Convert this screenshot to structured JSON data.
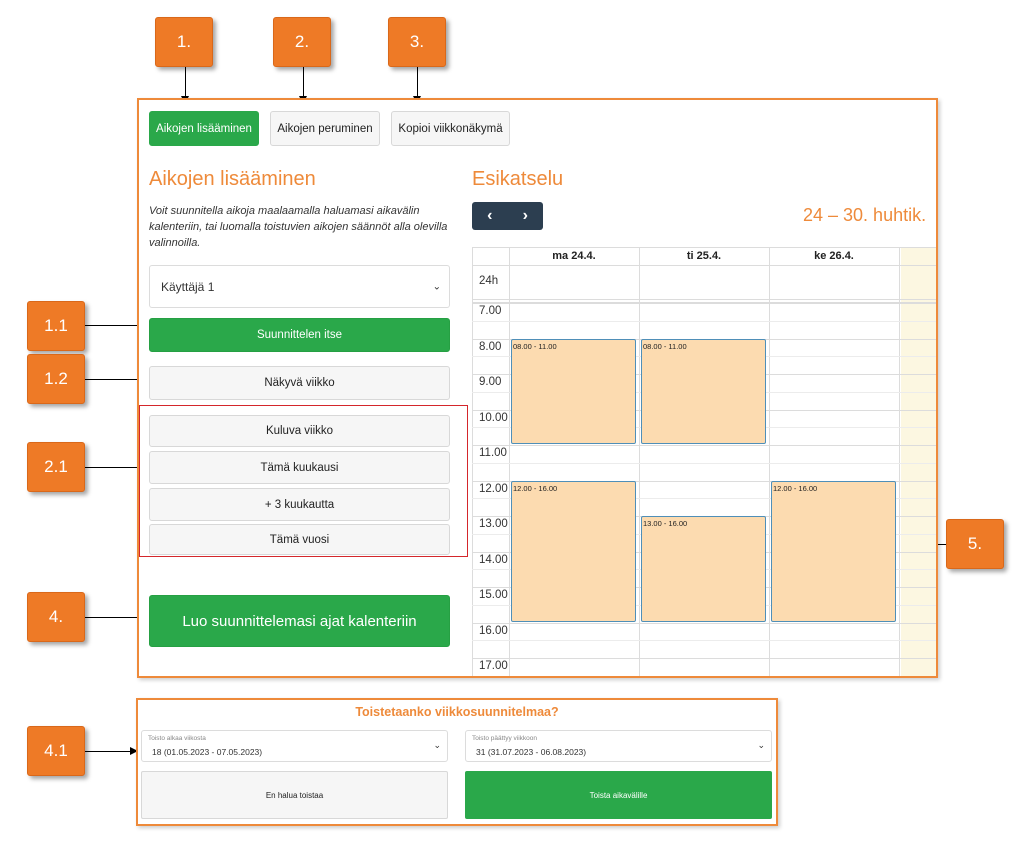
{
  "callouts": {
    "c1": "1.",
    "c2": "2.",
    "c3": "3.",
    "c11": "1.1",
    "c12": "1.2",
    "c21": "2.1",
    "c4": "4.",
    "c41": "4.1",
    "c5": "5."
  },
  "tabs": [
    {
      "label": "Aikojen lisääminen",
      "active": true
    },
    {
      "label": "Aikojen peruminen",
      "active": false
    },
    {
      "label": "Kopioi viikkonäkymä",
      "active": false
    }
  ],
  "left": {
    "heading": "Aikojen lisääminen",
    "description": "Voit suunnitella aikoja maalaamalla haluamasi aikavälin kalenteriin, tai luomalla toistuvien aikojen säännöt alla olevilla valinnoilla.",
    "user_select": "Käyttäjä 1",
    "plan_self": "Suunnittelen itse",
    "visible_week": "Näkyvä viikko",
    "current_week": "Kuluva viikko",
    "this_month": "Tämä kuukausi",
    "plus_3_months": "+ 3 kuukautta",
    "this_year": "Tämä vuosi",
    "create": "Luo suunnittelemasi ajat kalenteriin"
  },
  "preview": {
    "heading": "Esikatselu",
    "prev": "‹",
    "next": "›",
    "range": "24 – 30. huhtik.",
    "days": [
      "ma 24.4.",
      "ti 25.4.",
      "ke 26.4."
    ],
    "allday_label": "24h",
    "times": [
      "7.00",
      "8.00",
      "9.00",
      "10.00",
      "11.00",
      "12.00",
      "13.00",
      "14.00",
      "15.00",
      "16.00",
      "17.00"
    ],
    "events": [
      {
        "day": 0,
        "start": 8,
        "end": 11,
        "label": "08.00 - 11.00"
      },
      {
        "day": 1,
        "start": 8,
        "end": 11,
        "label": "08.00 - 11.00"
      },
      {
        "day": 0,
        "start": 12,
        "end": 16,
        "label": "12.00 - 16.00"
      },
      {
        "day": 1,
        "start": 13,
        "end": 16,
        "label": "13.00 - 16.00"
      },
      {
        "day": 2,
        "start": 12,
        "end": 16,
        "label": "12.00 - 16.00"
      }
    ]
  },
  "repeat": {
    "title": "Toistetaanko viikkosuunnitelmaa?",
    "start_label": "Toisto alkaa viikosta",
    "start_value": "18 (01.05.2023 - 07.05.2023)",
    "end_label": "Toisto päättyy viikkoon",
    "end_value": "31 (31.07.2023 - 06.08.2023)",
    "no_repeat": "En halua toistaa",
    "repeat_range": "Toista aikavälille"
  },
  "colors": {
    "accent": "#ee8a3a",
    "green": "#2aa84a",
    "event_fill": "#fcdbb0",
    "nav_dark": "#2c3e50"
  }
}
